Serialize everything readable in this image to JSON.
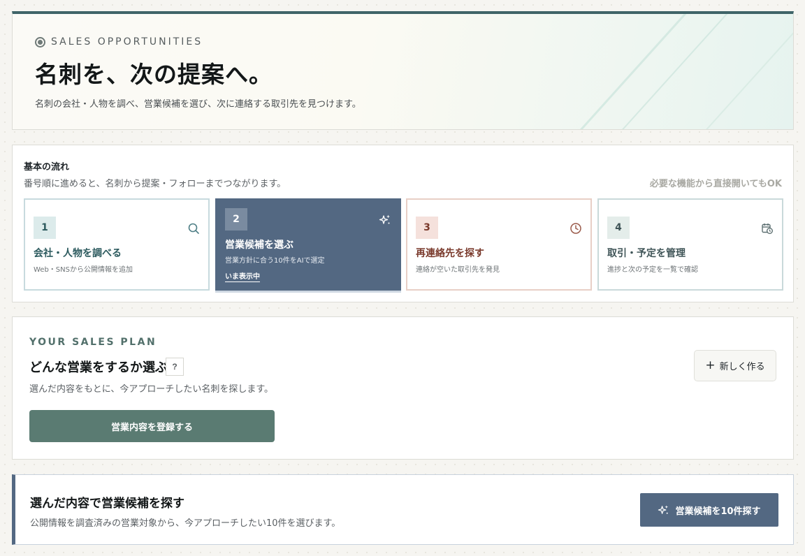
{
  "hero": {
    "eyebrow": "SALES OPPORTUNITIES",
    "title": "名刺を、次の提案へ。",
    "subtitle": "名刺の会社・人物を調べ、営業候補を選び、次に連絡する取引先を見つけます。"
  },
  "flow": {
    "title": "基本の流れ",
    "subtitle": "番号順に進めると、名刺から提案・フォローまでつながります。",
    "hint": "必要な機能から直接開いてもOK",
    "steps": [
      {
        "number": "1",
        "title": "会社・人物を調べる",
        "desc": "Web・SNSから公開情報を追加",
        "icon": "search-icon",
        "color": "#2c5a5e"
      },
      {
        "number": "2",
        "title": "営業候補を選ぶ",
        "desc": "営業方針に合う10件をAIで選定",
        "current": "いま表示中",
        "icon": "sparkle-icon",
        "color": "#536882"
      },
      {
        "number": "3",
        "title": "再連絡先を探す",
        "desc": "連絡が空いた取引先を発見",
        "icon": "clock-icon",
        "color": "#7a3a2c"
      },
      {
        "number": "4",
        "title": "取引・予定を管理",
        "desc": "進捗と次の予定を一覧で確認",
        "icon": "calendar-clock-icon",
        "color": "#3f5457"
      }
    ]
  },
  "plan": {
    "eyebrow": "YOUR SALES PLAN",
    "title": "どんな営業をするか選ぶ",
    "help": "?",
    "subtitle": "選んだ内容をもとに、今アプローチしたい名刺を探します。",
    "register_label": "営業内容を登録する",
    "new_label": "新しく作る",
    "new_icon": "plus-icon"
  },
  "search": {
    "title": "選んだ内容で営業候補を探す",
    "subtitle": "公開情報を調査済みの営業対象から、今アプローチしたい10件を選びます。",
    "button_label": "営業候補を10件探す",
    "button_icon": "sparkle-icon"
  },
  "colors": {
    "accent_dark": "#3f6468",
    "step_active": "#536882",
    "plan_button": "#5a7b72"
  }
}
